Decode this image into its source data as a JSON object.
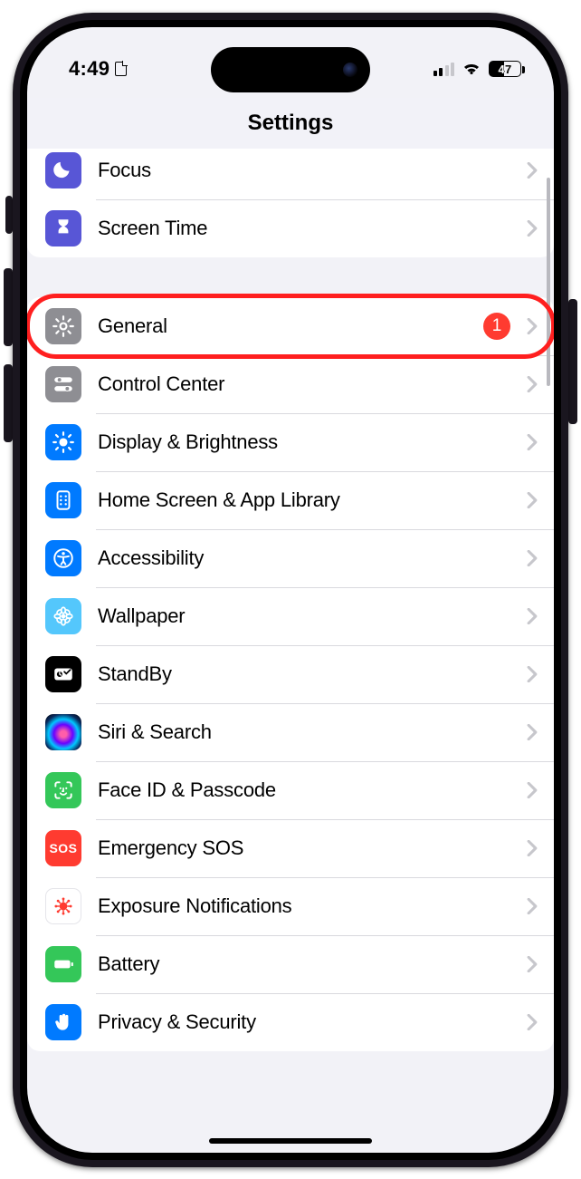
{
  "status": {
    "time": "4:49",
    "battery_pct": "47",
    "battery_fill_pct": 47,
    "cell_strength": 2
  },
  "nav": {
    "title": "Settings"
  },
  "groups": [
    {
      "rows": [
        {
          "id": "focus",
          "label": "Focus",
          "icon": "moon",
          "tile": "ic-indigo"
        },
        {
          "id": "screentime",
          "label": "Screen Time",
          "icon": "hourglass",
          "tile": "ic-indigo"
        }
      ]
    },
    {
      "rows": [
        {
          "id": "general",
          "label": "General",
          "icon": "gear",
          "tile": "ic-gray",
          "badge": "1",
          "highlight": true
        },
        {
          "id": "controlcenter",
          "label": "Control Center",
          "icon": "sliders",
          "tile": "ic-gray"
        },
        {
          "id": "display",
          "label": "Display & Brightness",
          "icon": "sun",
          "tile": "ic-blue"
        },
        {
          "id": "homescreen",
          "label": "Home Screen & App Library",
          "icon": "apps",
          "tile": "ic-blue"
        },
        {
          "id": "accessibility",
          "label": "Accessibility",
          "icon": "access",
          "tile": "ic-blue"
        },
        {
          "id": "wallpaper",
          "label": "Wallpaper",
          "icon": "flower",
          "tile": "ic-cyan"
        },
        {
          "id": "standby",
          "label": "StandBy",
          "icon": "clockcard",
          "tile": "ic-black"
        },
        {
          "id": "siri",
          "label": "Siri & Search",
          "icon": "siri",
          "tile": "ic-siri"
        },
        {
          "id": "faceid",
          "label": "Face ID & Passcode",
          "icon": "faceid",
          "tile": "ic-green"
        },
        {
          "id": "sos",
          "label": "Emergency SOS",
          "icon": "sos",
          "tile": "ic-red",
          "icon_text": "SOS"
        },
        {
          "id": "exposure",
          "label": "Exposure Notifications",
          "icon": "virus",
          "tile": "ic-white"
        },
        {
          "id": "battery",
          "label": "Battery",
          "icon": "battery",
          "tile": "ic-green"
        },
        {
          "id": "privacy",
          "label": "Privacy & Security",
          "icon": "hand",
          "tile": "ic-blue"
        }
      ]
    }
  ]
}
